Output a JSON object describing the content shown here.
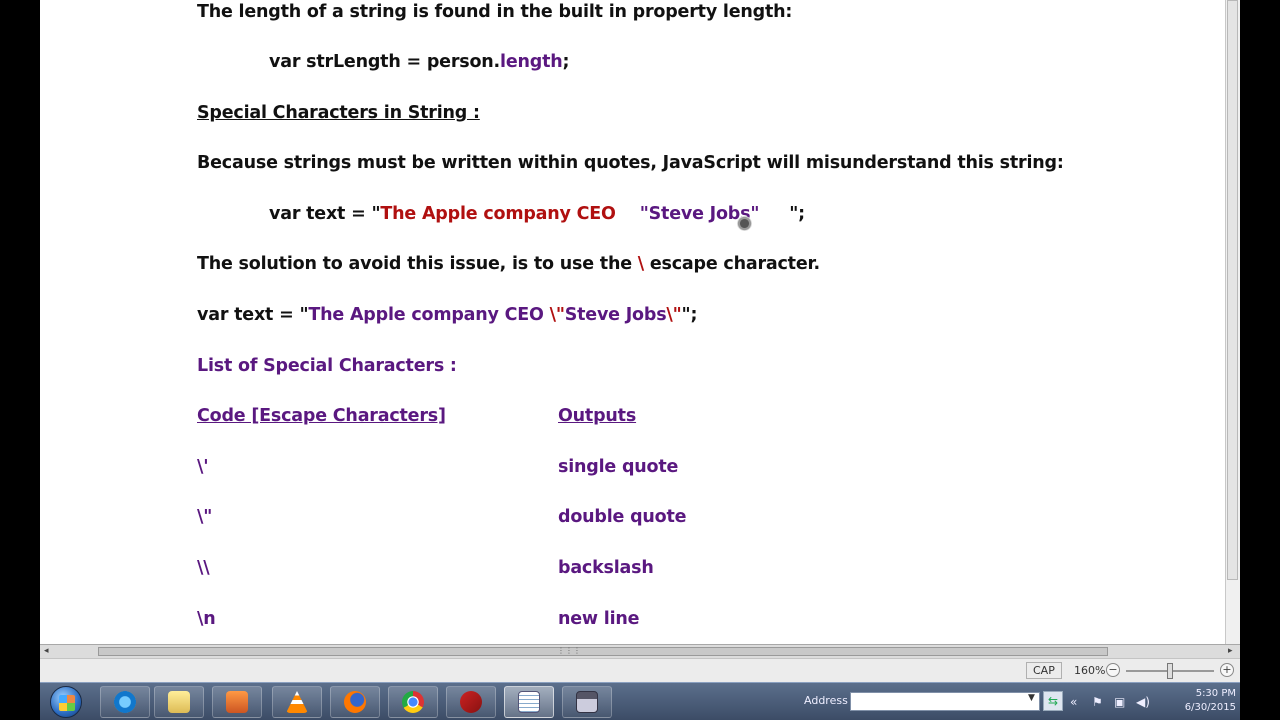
{
  "document": {
    "line1": "The length of a string is found in the built in property length:",
    "line2": {
      "code_a": "var strLength = person.",
      "code_b": "length",
      "code_c": ";"
    },
    "heading_special": "Special Characters in String :",
    "line_because": "Because strings must be written within quotes, JavaScript will misunderstand this string:",
    "line_var_text": {
      "a": "var text = \"",
      "b": "The Apple company CEO",
      "c": "\"Steve Jobs\"",
      "d": "\";"
    },
    "line_solution": {
      "a": "The solution to avoid this issue, is to use the ",
      "b": "\\",
      "c": " escape character."
    },
    "line_var_escaped": {
      "a": "var text = \"",
      "b": "The Apple company CEO ",
      "c": "\\\"",
      "d": "Steve Jobs",
      "e": "\\\"",
      "f": "\";"
    },
    "list_heading": "List of Special Characters :",
    "table": {
      "header_code": "Code [Escape Characters]",
      "header_output": "Outputs",
      "rows": [
        {
          "code": "\\'",
          "output": "single quote"
        },
        {
          "code": "\\\"",
          "output": "double quote"
        },
        {
          "code": "\\\\",
          "output": "backslash"
        },
        {
          "code": "\\n",
          "output": "new line"
        }
      ]
    }
  },
  "statusbar": {
    "caps": "CAP",
    "zoom": "160%",
    "zoom_minus": "−",
    "zoom_plus": "+",
    "zoom_level_fraction": 0.5
  },
  "taskbar": {
    "address_label": "Address",
    "address_value": "",
    "go_symbol": "⇆",
    "clock_time": "5:30 PM",
    "clock_date": "6/30/2015",
    "apps": [
      "start-orb",
      "internet-explorer",
      "file-explorer",
      "media-player",
      "vlc",
      "firefox",
      "chrome",
      "filezilla",
      "notepad",
      "floppy-save"
    ]
  },
  "colors": {
    "text": "#111111",
    "purple": "#5a1880",
    "red": "#b01010"
  }
}
